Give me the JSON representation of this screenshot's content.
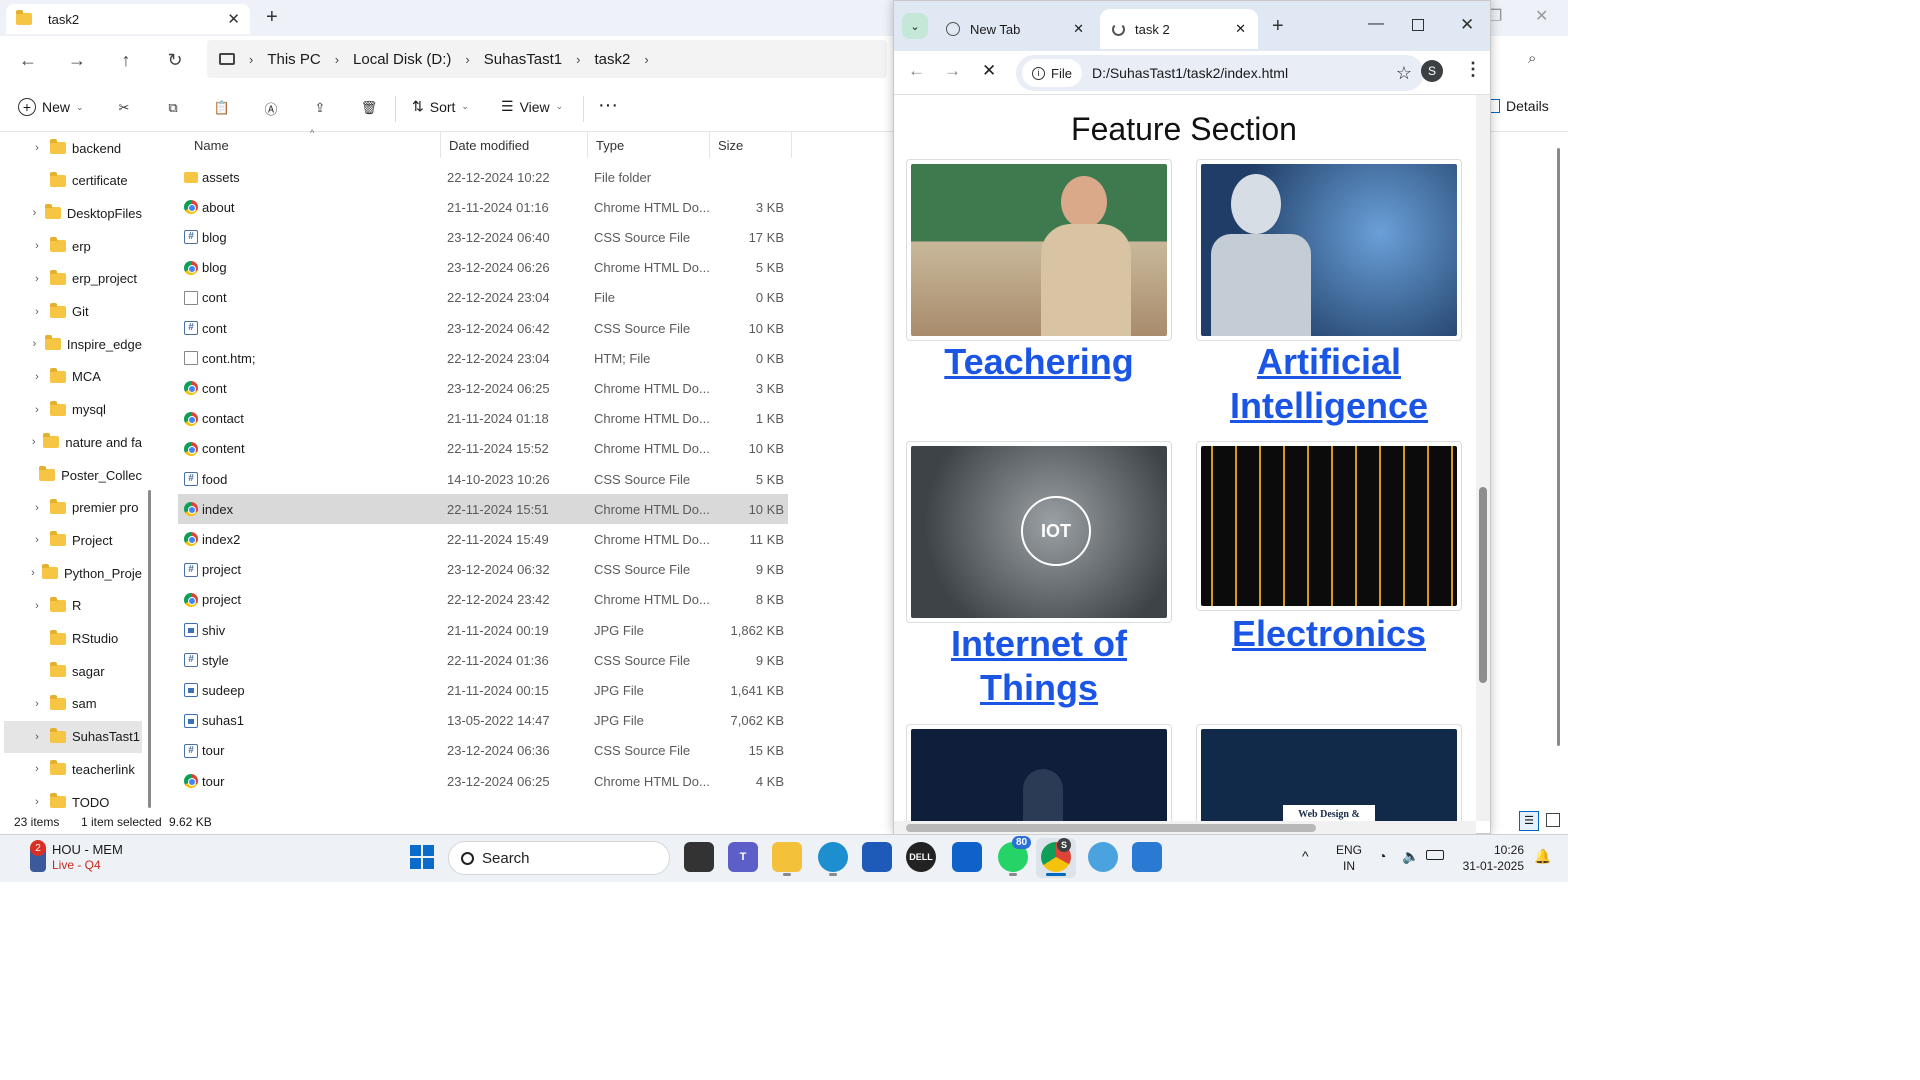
{
  "explorer": {
    "tab_title": "task2",
    "breadcrumb": [
      "This PC",
      "Local Disk (D:)",
      "SuhasTast1",
      "task2"
    ],
    "toolbar": {
      "new": "New",
      "sort": "Sort",
      "view": "View",
      "details": "Details"
    },
    "columns": {
      "name": "Name",
      "date": "Date modified",
      "type": "Type",
      "size": "Size"
    },
    "nav_items": [
      {
        "label": "backend",
        "expand": true
      },
      {
        "label": "certificate",
        "expand": false
      },
      {
        "label": "DesktopFiles",
        "expand": true
      },
      {
        "label": "erp",
        "expand": true
      },
      {
        "label": "erp_project",
        "expand": true
      },
      {
        "label": "Git",
        "expand": true
      },
      {
        "label": "Inspire_edge",
        "expand": true
      },
      {
        "label": "MCA",
        "expand": true
      },
      {
        "label": "mysql",
        "expand": true
      },
      {
        "label": "nature and fa",
        "expand": true
      },
      {
        "label": "Poster_Collec",
        "expand": false
      },
      {
        "label": "premier pro",
        "expand": true
      },
      {
        "label": "Project",
        "expand": true
      },
      {
        "label": "Python_Proje",
        "expand": true
      },
      {
        "label": "R",
        "expand": true
      },
      {
        "label": "RStudio",
        "expand": false
      },
      {
        "label": "sagar",
        "expand": false
      },
      {
        "label": "sam",
        "expand": true
      },
      {
        "label": "SuhasTast1",
        "expand": true,
        "selected": true
      },
      {
        "label": "teacherlink",
        "expand": true
      },
      {
        "label": "TODO",
        "expand": true
      }
    ],
    "files": [
      {
        "name": "assets",
        "date": "22-12-2024 10:22",
        "type": "File folder",
        "size": "",
        "icon": "folder-icon"
      },
      {
        "name": "about",
        "date": "21-11-2024 01:16",
        "type": "Chrome HTML Do...",
        "size": "3 KB",
        "icon": "chrome-html-icon"
      },
      {
        "name": "blog",
        "date": "23-12-2024 06:40",
        "type": "CSS Source File",
        "size": "17 KB",
        "icon": "css-file-icon"
      },
      {
        "name": "blog",
        "date": "23-12-2024 06:26",
        "type": "Chrome HTML Do...",
        "size": "5 KB",
        "icon": "chrome-html-icon"
      },
      {
        "name": "cont",
        "date": "22-12-2024 23:04",
        "type": "File",
        "size": "0 KB",
        "icon": "blank-file-icon"
      },
      {
        "name": "cont",
        "date": "23-12-2024 06:42",
        "type": "CSS Source File",
        "size": "10 KB",
        "icon": "css-file-icon"
      },
      {
        "name": "cont.htm;",
        "date": "22-12-2024 23:04",
        "type": "HTM; File",
        "size": "0 KB",
        "icon": "blank-file-icon"
      },
      {
        "name": "cont",
        "date": "23-12-2024 06:25",
        "type": "Chrome HTML Do...",
        "size": "3 KB",
        "icon": "chrome-html-icon"
      },
      {
        "name": "contact",
        "date": "21-11-2024 01:18",
        "type": "Chrome HTML Do...",
        "size": "1 KB",
        "icon": "chrome-html-icon"
      },
      {
        "name": "content",
        "date": "22-11-2024 15:52",
        "type": "Chrome HTML Do...",
        "size": "10 KB",
        "icon": "chrome-html-icon"
      },
      {
        "name": "food",
        "date": "14-10-2023 10:26",
        "type": "CSS Source File",
        "size": "5 KB",
        "icon": "css-file-icon"
      },
      {
        "name": "index",
        "date": "22-11-2024 15:51",
        "type": "Chrome HTML Do...",
        "size": "10 KB",
        "icon": "chrome-html-icon",
        "selected": true
      },
      {
        "name": "index2",
        "date": "22-11-2024 15:49",
        "type": "Chrome HTML Do...",
        "size": "11 KB",
        "icon": "chrome-html-icon"
      },
      {
        "name": "project",
        "date": "23-12-2024 06:32",
        "type": "CSS Source File",
        "size": "9 KB",
        "icon": "css-file-icon"
      },
      {
        "name": "project",
        "date": "22-12-2024 23:42",
        "type": "Chrome HTML Do...",
        "size": "8 KB",
        "icon": "chrome-html-icon"
      },
      {
        "name": "shiv",
        "date": "21-11-2024 00:19",
        "type": "JPG File",
        "size": "1,862 KB",
        "icon": "jpg-file-icon"
      },
      {
        "name": "style",
        "date": "22-11-2024 01:36",
        "type": "CSS Source File",
        "size": "9 KB",
        "icon": "css-file-icon"
      },
      {
        "name": "sudeep",
        "date": "21-11-2024 00:15",
        "type": "JPG File",
        "size": "1,641 KB",
        "icon": "jpg-file-icon"
      },
      {
        "name": "suhas1",
        "date": "13-05-2022 14:47",
        "type": "JPG File",
        "size": "7,062 KB",
        "icon": "jpg-file-icon"
      },
      {
        "name": "tour",
        "date": "23-12-2024 06:36",
        "type": "CSS Source File",
        "size": "15 KB",
        "icon": "css-file-icon"
      },
      {
        "name": "tour",
        "date": "23-12-2024 06:25",
        "type": "Chrome HTML Do...",
        "size": "4 KB",
        "icon": "chrome-html-icon"
      }
    ],
    "status": {
      "count": "23 items",
      "selection": "1 item selected",
      "size": "9.62 KB"
    }
  },
  "chrome": {
    "tabs": [
      {
        "label": "New Tab",
        "active": false
      },
      {
        "label": "task 2",
        "active": true
      }
    ],
    "site_chip": "File",
    "url": "D:/SuhasTast1/task2/index.html",
    "profile_initial": "S",
    "page": {
      "title": "Feature Section",
      "cards": [
        {
          "label": "Teachering"
        },
        {
          "label": "Artificial Intelligence"
        },
        {
          "label": "Internet of Things"
        },
        {
          "label": "Electronics"
        },
        {
          "label": ""
        },
        {
          "label": ""
        }
      ],
      "iot_badge": "IOT",
      "web_design_badge": "Web Design &"
    }
  },
  "taskbar": {
    "notification": {
      "badge": "2",
      "title": "HOU - MEM",
      "subtitle": "Live - Q4"
    },
    "search_placeholder": "Search",
    "whatsapp_badge": "80",
    "chrome_badge": "S",
    "lang_top": "ENG",
    "lang_bottom": "IN",
    "time": "10:26",
    "date": "31-01-2025"
  },
  "colors": {
    "link": "#1a55e6",
    "selection": "#d9d9d9",
    "accent": "#0067c0"
  }
}
